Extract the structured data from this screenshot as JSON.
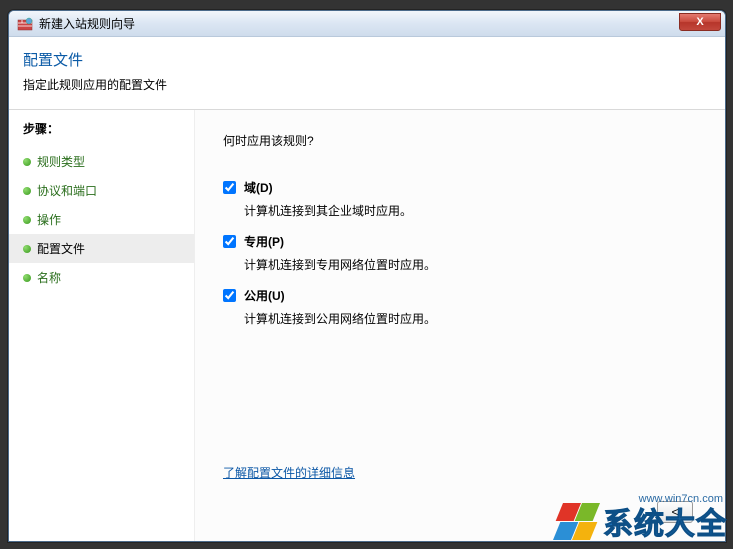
{
  "window": {
    "title": "新建入站规则向导",
    "close_glyph": "X"
  },
  "header": {
    "title": "配置文件",
    "subtitle": "指定此规则应用的配置文件"
  },
  "sidebar": {
    "heading": "步骤：",
    "items": [
      {
        "label": "规则类型",
        "current": false
      },
      {
        "label": "协议和端口",
        "current": false
      },
      {
        "label": "操作",
        "current": false
      },
      {
        "label": "配置文件",
        "current": true
      },
      {
        "label": "名称",
        "current": false
      }
    ]
  },
  "content": {
    "question": "何时应用该规则?",
    "options": [
      {
        "label": "域(D)",
        "desc": "计算机连接到其企业域时应用。",
        "checked": true
      },
      {
        "label": "专用(P)",
        "desc": "计算机连接到专用网络位置时应用。",
        "checked": true
      },
      {
        "label": "公用(U)",
        "desc": "计算机连接到公用网络位置时应用。",
        "checked": true
      }
    ],
    "learn_more": "了解配置文件的详细信息"
  },
  "footer": {
    "back_glyph": "<"
  },
  "watermark": {
    "text": "系统大全",
    "url": "www.win7cn.com"
  }
}
